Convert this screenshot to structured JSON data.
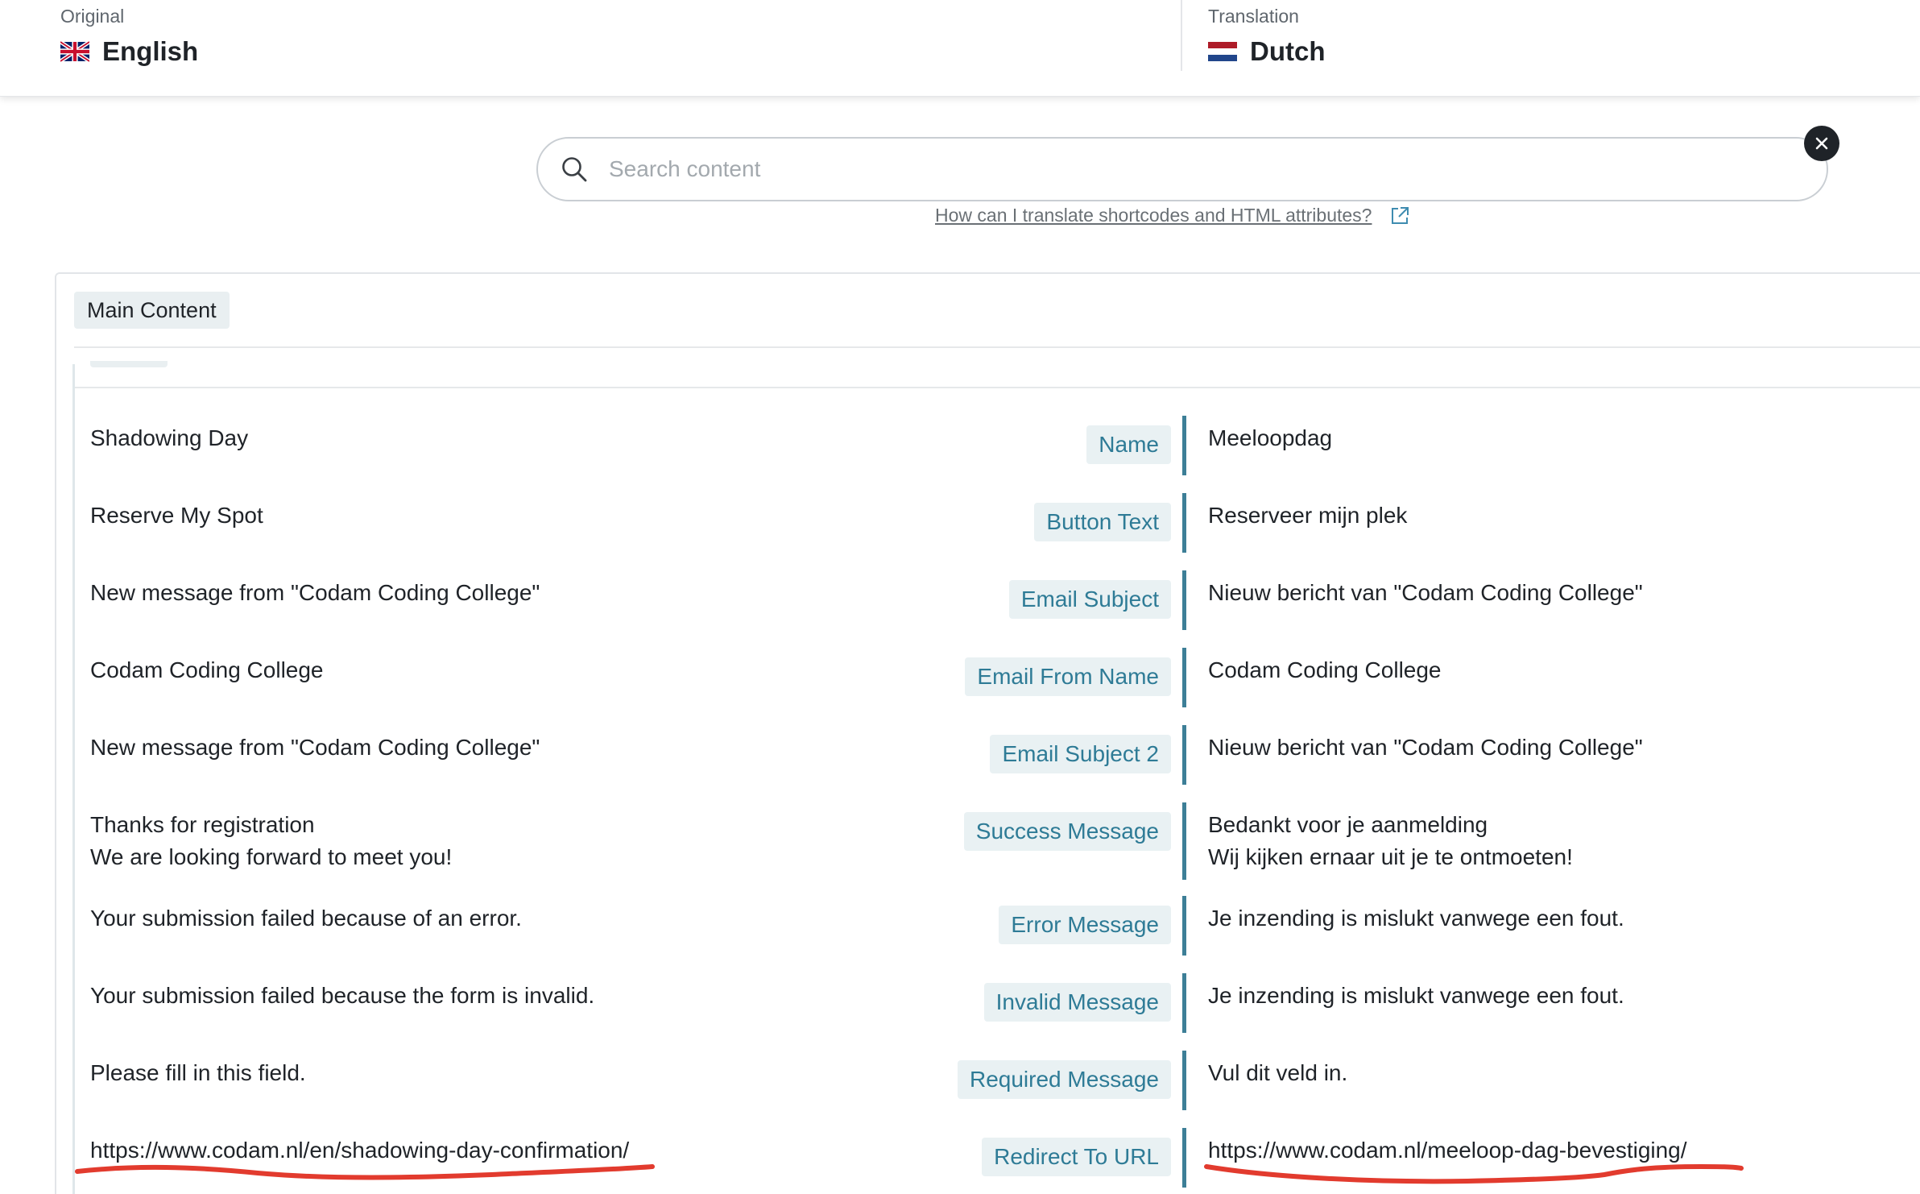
{
  "header": {
    "original_caption": "Original",
    "original_language": "English",
    "translation_caption": "Translation",
    "translation_language": "Dutch"
  },
  "search": {
    "placeholder": "Search content",
    "help_link": "How can I translate shortcodes and HTML attributes?"
  },
  "section": {
    "tag": "Main Content"
  },
  "rows": [
    {
      "original": "Shadowing Day",
      "label": "Name",
      "translation": "Meeloopdag"
    },
    {
      "original": "Reserve My Spot",
      "label": "Button Text",
      "translation": "Reserveer mijn plek"
    },
    {
      "original": "New message from \"Codam Coding College\"",
      "label": "Email Subject",
      "translation": "Nieuw bericht van \"Codam Coding College\""
    },
    {
      "original": "Codam Coding College",
      "label": "Email From Name",
      "translation": "Codam Coding College"
    },
    {
      "original": "New message from \"Codam Coding College\"",
      "label": "Email Subject 2",
      "translation": "Nieuw bericht van \"Codam Coding College\""
    },
    {
      "original": "Thanks for registration\nWe are looking forward to meet you!",
      "label": "Success Message",
      "translation": "Bedankt voor je aanmelding\nWij kijken ernaar uit je te ontmoeten!"
    },
    {
      "original": "Your submission failed because of an error.",
      "label": "Error Message",
      "translation": "Je inzending is mislukt vanwege een fout."
    },
    {
      "original": "Your submission failed because the form is invalid.",
      "label": "Invalid Message",
      "translation": "Je inzending is mislukt vanwege een fout."
    },
    {
      "original": "Please fill in this field.",
      "label": "Required Message",
      "translation": "Vul dit veld in."
    },
    {
      "original": "https://www.codam.nl/en/shadowing-day-confirmation/",
      "label": "Redirect To URL",
      "translation": "https://www.codam.nl/meeloop-dag-bevestiging/"
    }
  ],
  "colors": {
    "label_text": "#2e7b96",
    "label_bg": "#e9f1f3",
    "accent_bar": "#3d7f97",
    "annotation": "#e23b2e"
  },
  "icons": [
    "uk-flag-icon",
    "nl-flag-icon",
    "search-icon",
    "close-icon",
    "external-link-icon"
  ]
}
